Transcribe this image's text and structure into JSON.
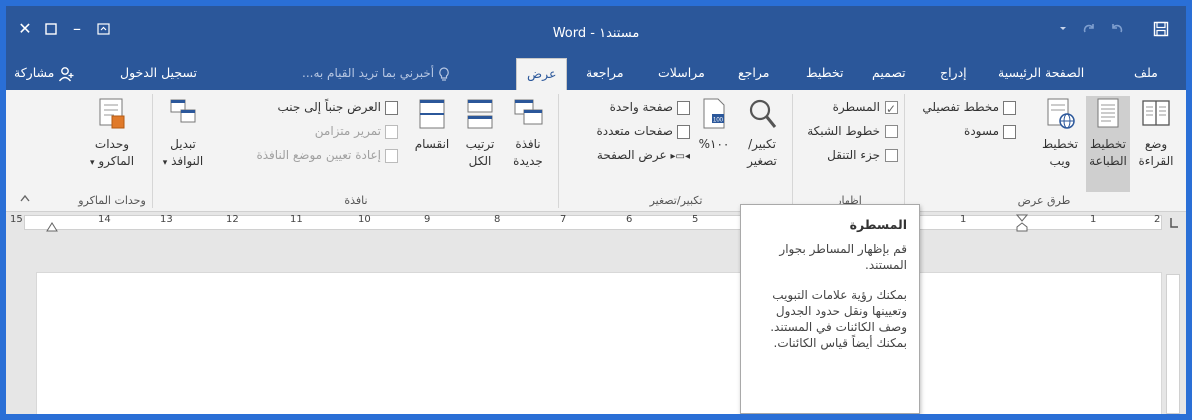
{
  "window": {
    "title": "مستند١ - Word"
  },
  "titlebar": {
    "close_glyph": "✕",
    "restore_glyph": "▫",
    "minimize_glyph": "–",
    "ribbon_display_glyph": "⊡",
    "save_icon": "save-icon",
    "undo_icon": "undo-icon",
    "redo_icon": "redo-icon",
    "customize_icon": "customize-qat-icon"
  },
  "tabs": [
    {
      "label": "ملف"
    },
    {
      "label": "الصفحة الرئيسية"
    },
    {
      "label": "إدراج"
    },
    {
      "label": "تصميم"
    },
    {
      "label": "تخطيط"
    },
    {
      "label": "مراجع"
    },
    {
      "label": "مراسلات"
    },
    {
      "label": "مراجعة"
    },
    {
      "label": "عرض",
      "active": true
    }
  ],
  "tellme": {
    "placeholder": "أخبرني بما تريد القيام به..."
  },
  "account": {
    "signin_label": "تسجيل الدخول",
    "share_label": "مشاركة"
  },
  "ribbon": {
    "views": {
      "group_label": "طرق عرض",
      "read_mode": "وضع القراءة",
      "print_layout": "تخطيط الطباعة",
      "web_layout": "تخطيط ويب",
      "outline": "مخطط تفصيلي",
      "draft": "مسودة"
    },
    "show": {
      "group_label": "إظهار",
      "ruler": "المسطرة",
      "ruler_checked": true,
      "gridlines": "خطوط الشبكة",
      "gridlines_checked": false,
      "nav_pane": "جزء التنقل",
      "nav_pane_checked": false
    },
    "zoom": {
      "group_label": "تكبير/تصغير",
      "zoom_label": "تكبير/ تصغير",
      "zoom_100": "١٠٠%",
      "one_page": "صفحة واحدة",
      "multiple_pages": "صفحات متعددة",
      "page_width": "عرض الصفحة"
    },
    "window": {
      "group_label": "نافذة",
      "new_window": "نافذة جديدة",
      "arrange_all": "ترتيب الكل",
      "split": "انقسام",
      "view_side_by_side": "العرض جنباً إلى جنب",
      "sync_scrolling": "تمرير متزامن",
      "reset_window_position": "إعادة تعيين موضع النافذة",
      "switch_windows": "تبديل النوافذ"
    },
    "macros": {
      "group_label": "وحدات الماكرو",
      "macros_label": "وحدات الماكرو"
    }
  },
  "ruler": {
    "numbers": [
      "15",
      "14",
      "13",
      "12",
      "11",
      "10",
      "9",
      "8",
      "7",
      "6",
      "5",
      "1",
      "1",
      "2"
    ]
  },
  "tooltip": {
    "title": "المسطرة",
    "line1": "قم بإظهار المساطر بجوار المستند.",
    "line2": "بمكنك رؤية علامات التبويب وتعيينها ونقل حدود الجدول وصف الكائنات في المستند. بمكنك أيضاً قياس الكائنات."
  },
  "colors": {
    "title_bar": "#2b579a",
    "ribbon_bg": "#f3f3f3",
    "workspace": "#e6e6e6"
  }
}
